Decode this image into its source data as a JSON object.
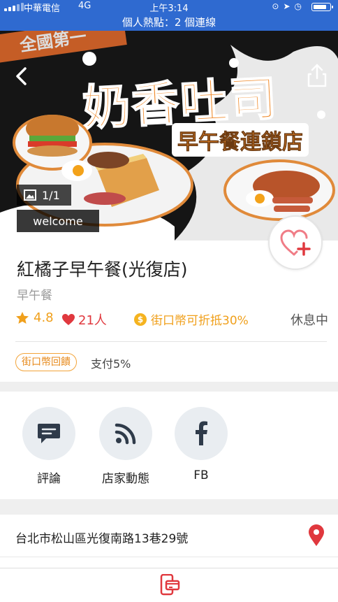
{
  "status_bar": {
    "carrier": "中華電信",
    "network": "4G",
    "time": "上午3:14",
    "hotspot": "個人熱點：2 個連線"
  },
  "hero": {
    "banner_corner_text": "全國第一",
    "banner_title": "奶香吐司",
    "banner_subtitle": "早午餐連鎖店",
    "photo_count": "1/1",
    "caption": "welcome"
  },
  "store": {
    "name": "紅橘子早午餐(光復店)",
    "category": "早午餐",
    "rating": "4.8",
    "likes": "21人",
    "coin_offer": "街口幣可折抵30%",
    "status": "休息中",
    "tag": "街口幣回饋",
    "pay_text": "支付5%"
  },
  "actions": [
    {
      "label": "評論"
    },
    {
      "label": "店家動態"
    },
    {
      "label": "FB"
    }
  ],
  "address": "台北市松山區光復南路13巷29號",
  "colors": {
    "status_bar": "#2f6ad0",
    "accent_orange": "#f0a01c",
    "heart_red": "#e0383e",
    "action_circle": "#e9edf1",
    "icon_dark": "#2f3b4a"
  }
}
